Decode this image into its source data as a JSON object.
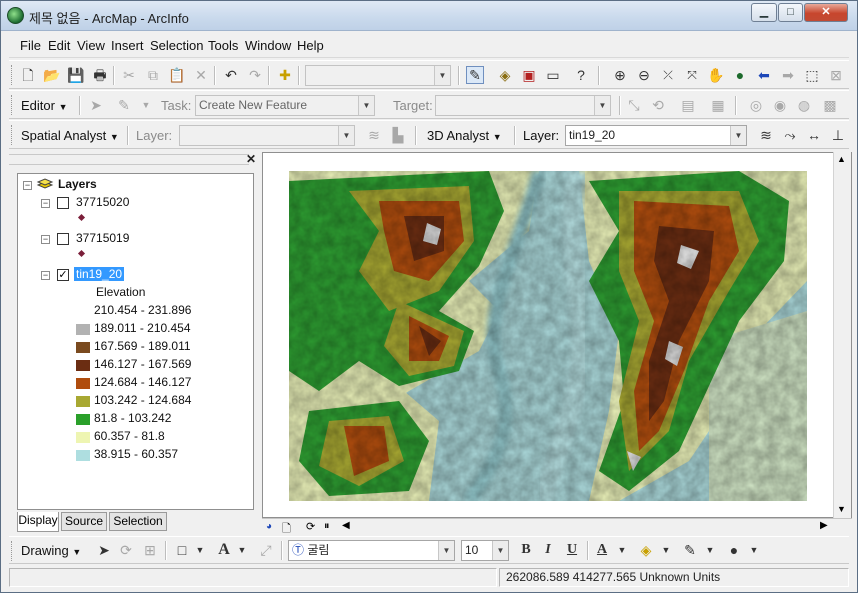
{
  "window": {
    "title": "제목 없음 - ArcMap - ArcInfo",
    "minimize": "▁",
    "maximize": "□",
    "close": "✕"
  },
  "menu": [
    "File",
    "Edit",
    "View",
    "Insert",
    "Selection",
    "Tools",
    "Window",
    "Help"
  ],
  "standard_toolbar": {
    "scale_value": ""
  },
  "editor_toolbar": {
    "editor_label": "Editor",
    "task_label": "Task:",
    "task_value": "Create New Feature",
    "target_label": "Target:",
    "target_value": ""
  },
  "spatial_toolbar": {
    "spatial_label": "Spatial Analyst",
    "layer_label": "Layer:",
    "layer_value": "",
    "analyst3d_label": "3D Analyst",
    "layer3d_label": "Layer:",
    "layer3d_value": "tin19_20"
  },
  "toc": {
    "root": "Layers",
    "layers": [
      {
        "name": "37715020",
        "checked": false
      },
      {
        "name": "37715019",
        "checked": false
      },
      {
        "name": "tin19_20",
        "checked": true
      }
    ],
    "legend_title": "Elevation",
    "legend": [
      {
        "label": "210.454 - 231.896",
        "color": "#ffffff"
      },
      {
        "label": "189.011 - 210.454",
        "color": "#b2b2b2"
      },
      {
        "label": "167.569 - 189.011",
        "color": "#7a4a1f"
      },
      {
        "label": "146.127 - 167.569",
        "color": "#6b2d12"
      },
      {
        "label": "124.684 - 146.127",
        "color": "#b04d0e"
      },
      {
        "label": "103.242 - 124.684",
        "color": "#a8a832"
      },
      {
        "label": "81.8 - 103.242",
        "color": "#2aa02a"
      },
      {
        "label": "60.357 - 81.8",
        "color": "#eef5b2"
      },
      {
        "label": "38.915 - 60.357",
        "color": "#aedee0"
      }
    ],
    "tabs": [
      "Display",
      "Source",
      "Selection"
    ]
  },
  "drawing_toolbar": {
    "drawing_label": "Drawing",
    "font_value": "굴림",
    "size_value": "10",
    "bold": "B",
    "italic": "I",
    "underline": "U",
    "font_color": "A"
  },
  "status": {
    "coordinates": "262086.589  414277.565 Unknown Units"
  }
}
